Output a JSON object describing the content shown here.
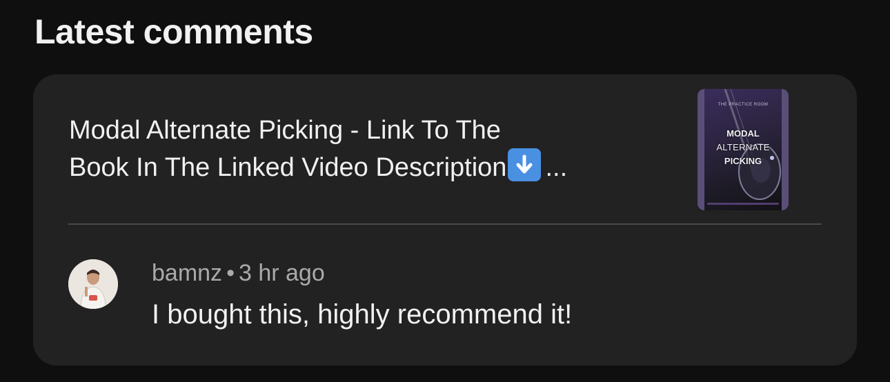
{
  "section": {
    "title": "Latest comments"
  },
  "video": {
    "title_line1": "Modal Alternate Picking - Link To The",
    "title_line2_start": "Book In The Linked Video Description",
    "title_line2_end": "...",
    "thumbnail": {
      "top_text": "THE PRACTICE ROOM",
      "line1": "MODAL",
      "line2": "ALTERNATE",
      "line3": "PICKING"
    }
  },
  "comment": {
    "author": "bamnz",
    "separator": "•",
    "time": "3 hr ago",
    "text": "I bought this, highly recommend it!"
  },
  "colors": {
    "background": "#0f0f0f",
    "card": "#222222",
    "meta_text": "#aaaaaa",
    "emoji_blue": "#4a90e2"
  }
}
